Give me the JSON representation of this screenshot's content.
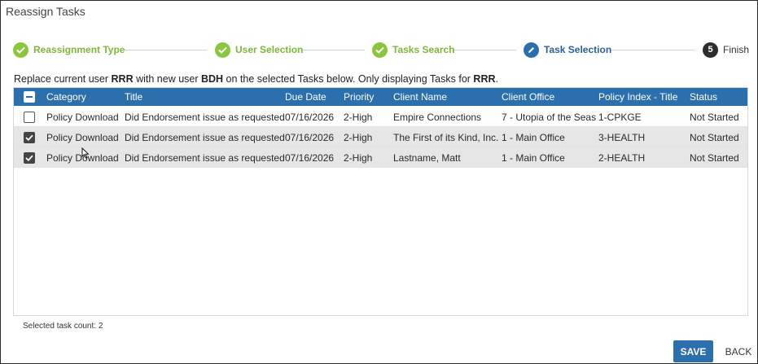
{
  "dialog": {
    "title": "Reassign Tasks"
  },
  "stepper": {
    "steps": [
      {
        "label": "Reassignment Type",
        "state": "done"
      },
      {
        "label": "User Selection",
        "state": "done"
      },
      {
        "label": "Tasks Search",
        "state": "done"
      },
      {
        "label": "Task Selection",
        "state": "active"
      },
      {
        "number": "5",
        "label": "Finish",
        "state": "todo"
      }
    ]
  },
  "instruction": {
    "p1": "Replace current user ",
    "current_user": "RRR",
    "p2": " with new user ",
    "new_user": "BDH",
    "p3": " on the selected Tasks below. Only displaying Tasks for ",
    "display_user": "RRR",
    "p4": "."
  },
  "table": {
    "columns": [
      "Category",
      "Title",
      "Due Date",
      "Priority",
      "Client Name",
      "Client Office",
      "Policy Index - Title",
      "Status"
    ],
    "rows": [
      {
        "checked": false,
        "category": "Policy Download",
        "title": "Did Endorsement issue as requested",
        "due_date": "07/16/2026",
        "priority": "2-High",
        "client_name": "Empire Connections",
        "client_office": "7 - Utopia of the Seas",
        "policy": "1-CPKGE",
        "status": "Not Started"
      },
      {
        "checked": true,
        "category": "Policy Download",
        "title": "Did Endorsement issue as requested",
        "due_date": "07/16/2026",
        "priority": "2-High",
        "client_name": "The First of its Kind, Inc.",
        "client_office": "1 - Main Office",
        "policy": "3-HEALTH",
        "status": "Not Started"
      },
      {
        "checked": true,
        "category": "Policy Download",
        "title": "Did Endorsement issue as requested",
        "due_date": "07/16/2026",
        "priority": "2-High",
        "client_name": "Lastname, Matt",
        "client_office": "1 - Main Office",
        "policy": "2-HEALTH",
        "status": "Not Started"
      }
    ]
  },
  "footer": {
    "selected_count_text": "Selected task count: 2",
    "save_label": "SAVE",
    "back_label": "BACK"
  },
  "colors": {
    "accent": "#2c6fad",
    "step_done": "#8cc63f",
    "row_selected": "#e6e6e6"
  }
}
